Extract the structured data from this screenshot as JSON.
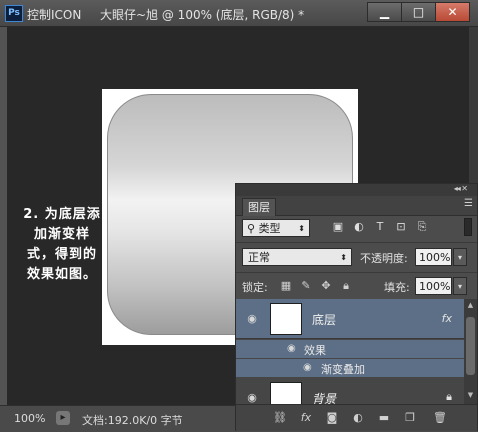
{
  "window": {
    "app_title": "控制ICON",
    "document_title": "大眼仔~旭 @ 100% (底层, RGB/8) *",
    "buttons": {
      "minimize": "▁",
      "restore": "□",
      "close": "✕"
    }
  },
  "annotation": {
    "lines": [
      "2. 为底层添",
      "加渐变样",
      "式，得到的",
      "效果如图。"
    ]
  },
  "status": {
    "zoom": "100%",
    "doc_info": "文档:192.0K/0 字节"
  },
  "layers_panel": {
    "tab": "图层",
    "filter_kind": "类型",
    "blend_mode": "正常",
    "opacity_label": "不透明度:",
    "opacity_value": "100%",
    "lock_label": "锁定:",
    "fill_label": "填充:",
    "fill_value": "100%",
    "layers": [
      {
        "name": "底层",
        "fx": "fx",
        "selected": true
      },
      {
        "name": "背景",
        "locked": true
      }
    ],
    "effects_label": "效果",
    "effect_item": "渐变叠加"
  },
  "icons": {
    "eye": "visibility-eye-icon",
    "link": "link-icon",
    "fx": "fx-icon",
    "mask": "mask-icon",
    "adjustment": "adjustment-icon",
    "group": "folder-icon",
    "new_layer": "new-layer-icon",
    "delete": "trash-icon"
  },
  "colors": {
    "selected_layer": "#5d6f86",
    "canvas_bg": "#282828"
  }
}
